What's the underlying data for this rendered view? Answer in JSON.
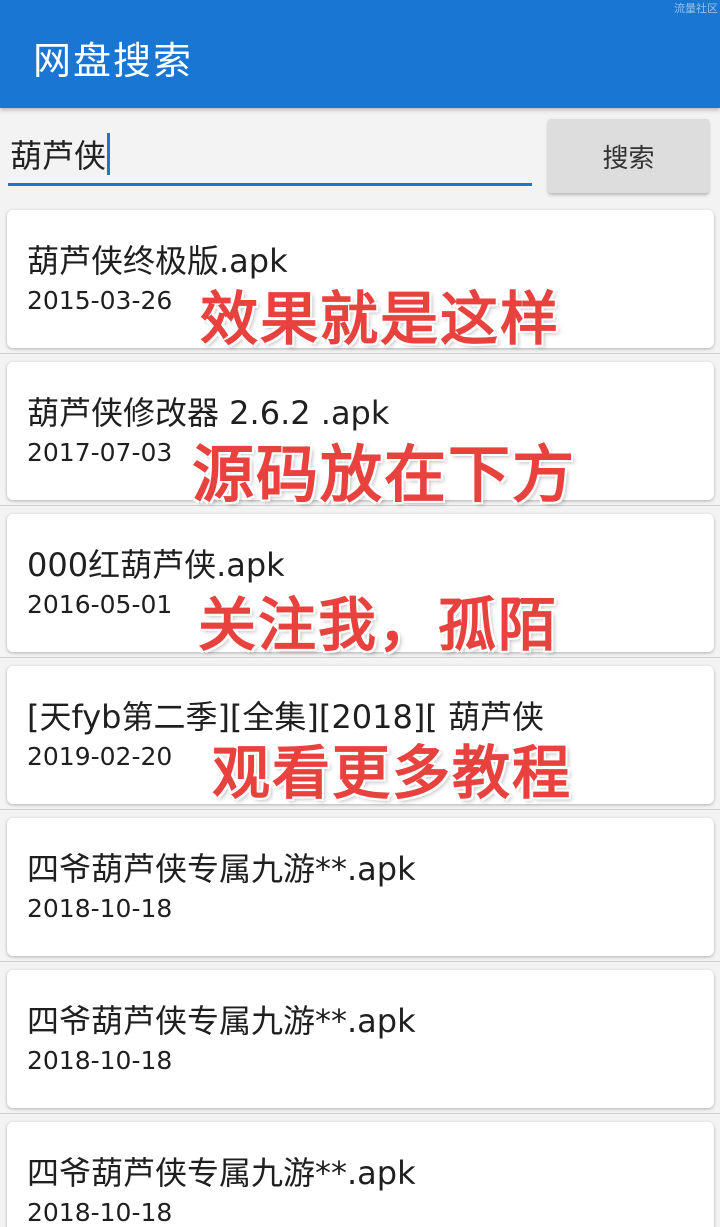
{
  "appbar": {
    "title": "网盘搜索",
    "watermark": "流量社区",
    "color": "#1976d2"
  },
  "search": {
    "value": "葫芦侠",
    "button_label": "搜索"
  },
  "results": [
    {
      "title": "葫芦侠终极版.apk",
      "date": "2015-03-26",
      "overlay": "效果就是这样"
    },
    {
      "title": "葫芦侠修改器 2.6.2 .apk",
      "date": "2017-07-03",
      "overlay": "源码放在下方"
    },
    {
      "title": "000红葫芦侠.apk",
      "date": "2016-05-01",
      "overlay": "关注我，孤陌"
    },
    {
      "title": "[天fyb第二季][全集][2018][ 葫芦侠",
      "date": "2019-02-20",
      "overlay": "观看更多教程"
    },
    {
      "title": "四爷葫芦侠专属九游**.apk",
      "date": "2018-10-18",
      "overlay": ""
    },
    {
      "title": "四爷葫芦侠专属九游**.apk",
      "date": "2018-10-18",
      "overlay": ""
    },
    {
      "title": "四爷葫芦侠专属九游**.apk",
      "date": "2018-10-18",
      "overlay": ""
    }
  ]
}
